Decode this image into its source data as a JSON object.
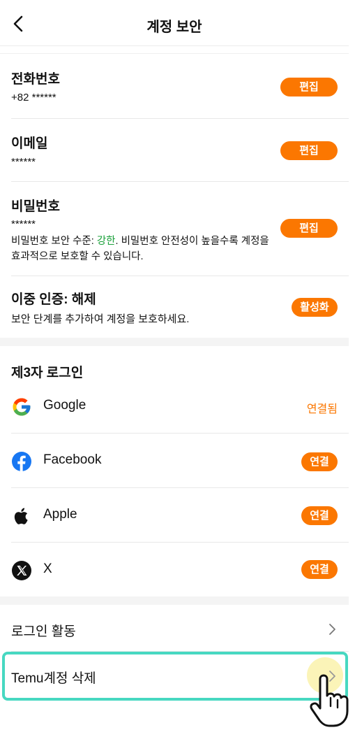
{
  "header": {
    "title": "계정 보안",
    "back_icon": "chevron-left-icon"
  },
  "account": {
    "phone": {
      "label": "전화번호",
      "value": "+82 ******",
      "button": "편집"
    },
    "email": {
      "label": "이메일",
      "value": "******",
      "button": "편집"
    },
    "password": {
      "label": "비밀번호",
      "value": "******",
      "desc_before": "비밀번호 보안 수준: ",
      "strength": "강한",
      "desc_after": ". 비밀번호 안전성이 높을수록 계정을 효과적으로 보호할 수 있습니다.",
      "button": "편집",
      "strength_color": "#1aa03a"
    },
    "two_factor": {
      "label": "이중 인증: 해제",
      "desc": "보안 단계를 추가하여 계정을 보호하세요.",
      "button": "활성화"
    }
  },
  "third_party": {
    "title": "제3자 로그인",
    "items": [
      {
        "name": "Google",
        "icon": "google-icon",
        "action": "연결됨"
      },
      {
        "name": "Facebook",
        "icon": "facebook-icon",
        "action": "연결"
      },
      {
        "name": "Apple",
        "icon": "apple-icon",
        "action": "연결"
      },
      {
        "name": "X",
        "icon": "x-icon",
        "action": "연결"
      }
    ]
  },
  "links": {
    "login_activity": "로그인 활동",
    "delete_account": "Temu계정 삭제"
  },
  "colors": {
    "accent": "#fb7701",
    "highlight": "#47d8c1"
  }
}
